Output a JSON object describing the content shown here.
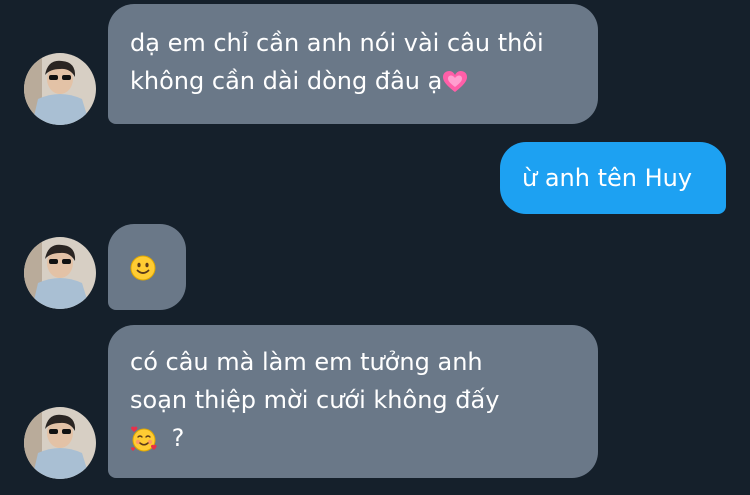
{
  "colors": {
    "background": "#15202b",
    "incoming_bubble": "#6a7888",
    "outgoing_bubble": "#1da1f2",
    "text": "#ffffff"
  },
  "messages": [
    {
      "direction": "incoming",
      "lines": [
        "dạ em chỉ cần anh nói vài câu thôi",
        "không cần dài dòng đâu ạ"
      ],
      "trailing_emoji": "growing-heart-icon"
    },
    {
      "direction": "outgoing",
      "lines": [
        "ừ anh tên Huy"
      ]
    },
    {
      "direction": "incoming",
      "lines": [],
      "emoji": "slightly-smiling-face-icon"
    },
    {
      "direction": "incoming",
      "lines": [
        "có câu mà làm em tưởng anh",
        "soạn thiệp mời cưới không đấy",
        "?"
      ],
      "leading_emoji": "smiling-face-with-hearts-icon"
    }
  ]
}
